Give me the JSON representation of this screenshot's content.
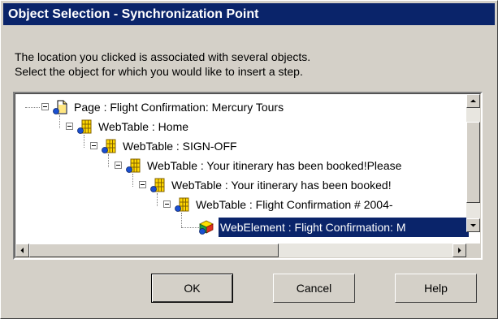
{
  "dialog": {
    "title": "Object Selection - Synchronization Point",
    "message_line1": "The location you clicked is associated with several objects.",
    "message_line2": "Select the object for which you would like to insert a step."
  },
  "tree": {
    "items": [
      {
        "label": "Page : Flight Confirmation: Mercury Tours",
        "icon": "page-icon"
      },
      {
        "label": "WebTable : Home",
        "icon": "webtable-icon"
      },
      {
        "label": "WebTable : SIGN-OFF",
        "icon": "webtable-icon"
      },
      {
        "label": "WebTable : Your itinerary has been booked!Please",
        "icon": "webtable-icon"
      },
      {
        "label": "WebTable : Your itinerary has been booked!",
        "icon": "webtable-icon"
      },
      {
        "label": "WebTable :  Flight Confirmation # 2004-",
        "icon": "webtable-icon"
      },
      {
        "label": "WebElement : Flight Confirmation: M",
        "icon": "webelement-icon",
        "selected": true
      }
    ]
  },
  "buttons": {
    "ok": "OK",
    "cancel": "Cancel",
    "help": "Help"
  }
}
